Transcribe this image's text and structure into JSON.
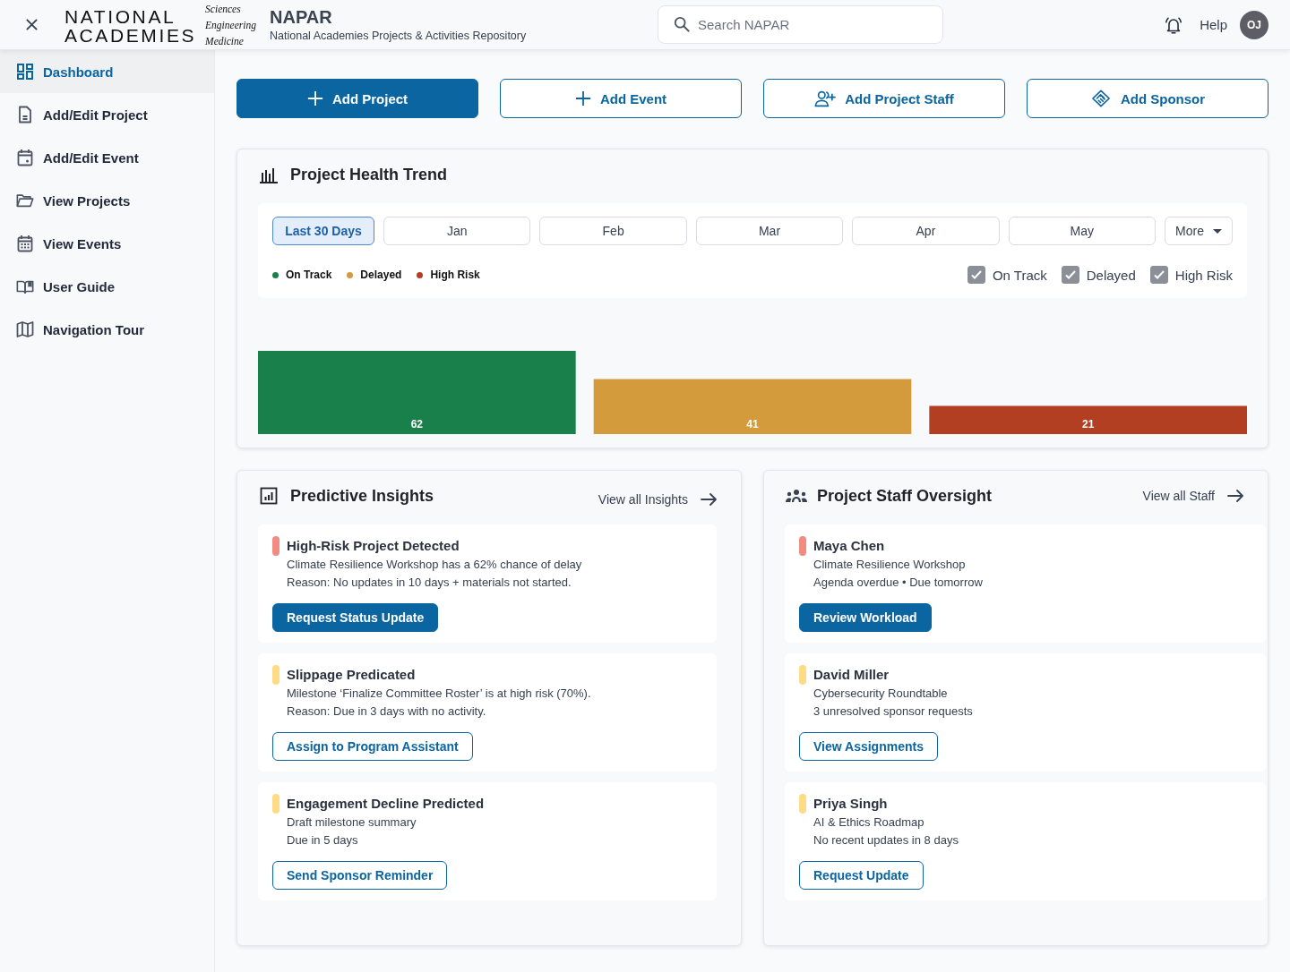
{
  "header": {
    "logo": {
      "name_lines": [
        "NATIONAL",
        "ACADEMIES"
      ],
      "tagline_lines": [
        "Sciences",
        "Engineering",
        "Medicine"
      ]
    },
    "app_title": "NAPAR",
    "app_subtitle": "National Academies Projects & Activities Repository",
    "search": {
      "placeholder": "Search NAPAR"
    },
    "help": "Help",
    "avatar": "OJ"
  },
  "sidebar": {
    "items": [
      {
        "label": "Dashboard",
        "selected": true
      },
      {
        "label": "Add/Edit Project",
        "selected": false
      },
      {
        "label": "Add/Edit Event",
        "selected": false
      },
      {
        "label": "View Projects",
        "selected": false
      },
      {
        "label": "View Events",
        "selected": false
      },
      {
        "label": "User Guide",
        "selected": false
      },
      {
        "label": "Navigation Tour",
        "selected": false
      }
    ]
  },
  "actions": [
    {
      "label": "Add Project",
      "kind": "filled"
    },
    {
      "label": "Add Event",
      "kind": "outline"
    },
    {
      "label": "Add Project Staff",
      "kind": "outline"
    },
    {
      "label": "Add Sponsor",
      "kind": "outline"
    }
  ],
  "health_trend": {
    "title": "Project Health Trend",
    "periods": [
      {
        "label": "Last 30 Days",
        "selected": true
      },
      {
        "label": "Jan",
        "selected": false
      },
      {
        "label": "Feb",
        "selected": false
      },
      {
        "label": "Mar",
        "selected": false
      },
      {
        "label": "Apr",
        "selected": false
      },
      {
        "label": "May",
        "selected": false
      }
    ],
    "more": "More",
    "filters": [
      {
        "label": "On Track",
        "checked": true
      },
      {
        "label": "Delayed",
        "checked": true
      },
      {
        "label": "High Risk",
        "checked": true
      }
    ],
    "chart_data": {
      "type": "bar",
      "series": [
        {
          "name": "On Track",
          "color": "#1a804b",
          "values": [
            62
          ]
        },
        {
          "name": "Delayed",
          "color": "#d39b3b",
          "values": [
            41
          ]
        },
        {
          "name": "High Risk",
          "color": "#b33f22",
          "values": [
            21
          ]
        }
      ],
      "data_labels": true
    }
  },
  "insights": {
    "title": "Predictive Insights",
    "link": "View all Insights",
    "items": [
      {
        "title": "High-Risk Project Detected",
        "color": "#f28b82",
        "lines": [
          "Climate Resilience Workshop has a 62% chance of delay",
          "Reason: No updates in 10 days + materials not started."
        ],
        "button": {
          "label": "Request Status Update",
          "kind": "filled"
        }
      },
      {
        "title": "Slippage Predicated",
        "color": "#fddc85",
        "lines": [
          "Milestone ‘Finalize Committee Roster’ is at high risk (70%).",
          "Reason: Due in 3 days with no activity."
        ],
        "button": {
          "label": "Assign to Program Assistant",
          "kind": "outline"
        }
      },
      {
        "title": "Engagement Decline Predicted",
        "color": "#fddc85",
        "lines": [
          "Draft milestone summary",
          "Due in 5 days"
        ],
        "button": {
          "label": "Send Sponsor Reminder",
          "kind": "outline"
        }
      }
    ]
  },
  "staff": {
    "title": "Project Staff Oversight",
    "link": "View all Staff",
    "items": [
      {
        "title": "Maya Chen",
        "color": "#f28b82",
        "lines": [
          "Climate Resilience Workshop",
          "Agenda overdue • Due tomorrow"
        ],
        "button": {
          "label": "Review Workload",
          "kind": "filled"
        }
      },
      {
        "title": "David Miller",
        "color": "#fddc85",
        "lines": [
          "Cybersecurity Roundtable",
          "3 unresolved sponsor requests"
        ],
        "button": {
          "label": "View Assignments",
          "kind": "outline"
        }
      },
      {
        "title": "Priya Singh",
        "color": "#fddc85",
        "lines": [
          "AI & Ethics Roadmap",
          "No recent updates in 8 days"
        ],
        "button": {
          "label": "Request Update",
          "kind": "outline"
        }
      }
    ]
  }
}
